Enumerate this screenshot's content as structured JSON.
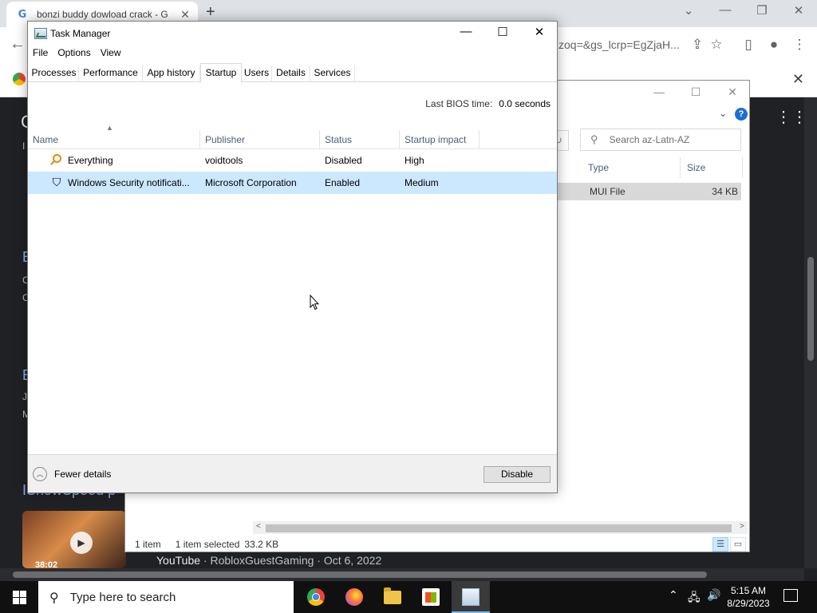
{
  "browser": {
    "tab_title": "bonzi buddy dowload crack - G",
    "tab_close": "✕",
    "new_tab": "+",
    "omnibox_url": "zoq=&gs_lcrp=EgZjaH...",
    "youtube_duration": "38:02",
    "youtube_source": "YouTube",
    "youtube_meta": " · RobloxGuestGaming · Oct 6, 2022",
    "channel_fragment": "IShowSpeed p",
    "left_fragments": [
      "E",
      "E"
    ]
  },
  "explorer": {
    "search_placeholder": "Search az-Latn-AZ",
    "columns": [
      "Type",
      "Size"
    ],
    "row": {
      "type": "MUI File",
      "size": "34 KB"
    },
    "status": {
      "items": "1 item",
      "selected": "1 item selected",
      "size": "33.2 KB"
    }
  },
  "taskmanager": {
    "title": "Task Manager",
    "menu": [
      "File",
      "Options",
      "View"
    ],
    "tabs": [
      "Processes",
      "Performance",
      "App history",
      "Startup",
      "Users",
      "Details",
      "Services"
    ],
    "active_tab": "Startup",
    "bios_label": "Last BIOS time:",
    "bios_value": "0.0 seconds",
    "columns": [
      "Name",
      "Publisher",
      "Status",
      "Startup impact"
    ],
    "rows": [
      {
        "name": "Everything",
        "publisher": "voidtools",
        "status": "Disabled",
        "impact": "High"
      },
      {
        "name": "Windows Security notificati...",
        "publisher": "Microsoft Corporation",
        "status": "Enabled",
        "impact": "Medium"
      }
    ],
    "fewer_details": "Fewer details",
    "disable_button": "Disable"
  },
  "taskbar": {
    "search_placeholder": "Type here to search",
    "time": "5:15 AM",
    "date": "8/29/2023"
  },
  "colors": {
    "selection": "#cce8ff",
    "chrome_dark": "#202124",
    "taskbar": "#101010"
  }
}
